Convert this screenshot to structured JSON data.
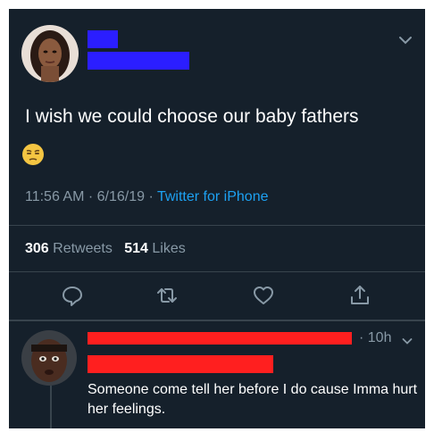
{
  "tweet": {
    "text": "I wish we could choose our baby fathers",
    "emoji": "😒",
    "time": "11:56 AM",
    "date": "6/16/19",
    "separator": "·",
    "source": "Twitter for iPhone",
    "retweets_count": "306",
    "retweets_label": "Retweets",
    "likes_count": "514",
    "likes_label": "Likes"
  },
  "actions": [
    "reply-icon",
    "retweet-icon",
    "like-icon",
    "share-icon"
  ],
  "reply": {
    "time": "· 10h",
    "text": "Someone come tell her before I do cause Imma hurt her feelings."
  },
  "colors": {
    "background": "#15202b",
    "muted": "#8899a6",
    "link": "#1da1f2",
    "redaction_blue": "#2b1eff",
    "redaction_red": "#ff1f1f"
  }
}
